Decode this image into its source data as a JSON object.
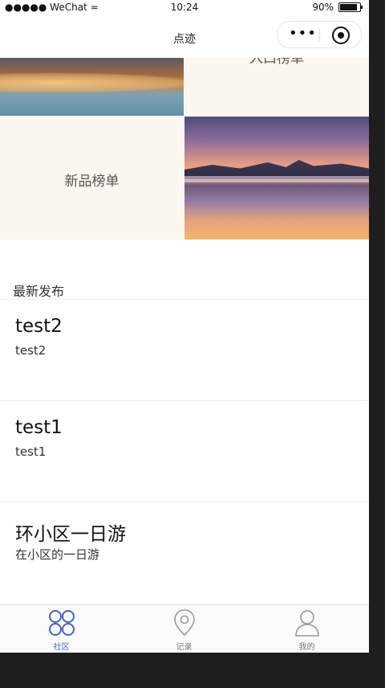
{
  "status_bar": {
    "carrier": "●●●●● WeChat",
    "wifi": "≈",
    "time": "10:24",
    "battery": "90%"
  },
  "navbar": {
    "title": "点迹",
    "menu_glyph": "•••"
  },
  "grid": {
    "tile_top_right": "入口榜单",
    "tile_new": "新品榜单"
  },
  "section": {
    "title": "最新发布"
  },
  "posts": [
    {
      "title": "test2",
      "subtitle": "test2"
    },
    {
      "title": "test1",
      "subtitle": "test1"
    },
    {
      "title": "环小区一日游",
      "subtitle": "在小区的一日游"
    }
  ],
  "tabbar": {
    "tabs": [
      {
        "label": "社区",
        "icon": "community-grid-icon",
        "active": true
      },
      {
        "label": "记录",
        "icon": "location-pin-icon",
        "active": false
      },
      {
        "label": "我的",
        "icon": "user-profile-icon",
        "active": false
      }
    ]
  },
  "colors": {
    "accent": "#4a63b8",
    "inactive": "#999999"
  }
}
